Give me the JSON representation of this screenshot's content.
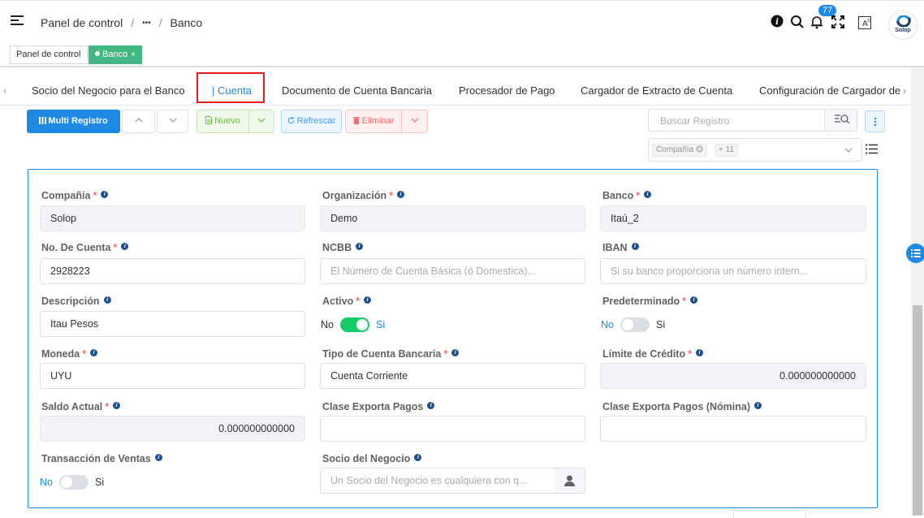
{
  "breadcrumb": {
    "home": "Panel de control",
    "ellipsis": "•••",
    "current": "Banco"
  },
  "header": {
    "notification_count": "77",
    "logo_text": "Solop"
  },
  "tags": {
    "items": [
      {
        "label": "Panel de control"
      },
      {
        "label": "Banco",
        "close": "×"
      }
    ],
    "active_color": "#42b983"
  },
  "tabs": {
    "items": [
      {
        "label": "Socio del Negocio para el Banco"
      },
      {
        "label": "| Cuenta"
      },
      {
        "label": "Documento de Cuenta Bancaria"
      },
      {
        "label": "Procesador de Pago"
      },
      {
        "label": "Cargador de Extracto de Cuenta"
      },
      {
        "label": "Configuración de Cargador de"
      }
    ],
    "active_index": 1,
    "left_arrow": "‹",
    "right_arrow": "›"
  },
  "toolbar": {
    "multi_registro": "Multi Registro",
    "nuevo": "Nuevo",
    "refrescar": "Refrescar",
    "eliminar": "Eliminar",
    "search_placeholder": "Buscar Registro",
    "filter_chip": "Compañía",
    "filter_more": "+ 11"
  },
  "form": {
    "compania": {
      "label": "Compañía",
      "value": "Solop"
    },
    "organizacion": {
      "label": "Organización",
      "value": "Demo"
    },
    "banco": {
      "label": "Banco",
      "value": "Itaú_2"
    },
    "no_cuenta": {
      "label": "No. De Cuenta",
      "value": "2928223"
    },
    "ncbb": {
      "label": "NCBB",
      "placeholder": "El Número de Cuenta Básica (ó Domestica)..."
    },
    "iban": {
      "label": "IBAN",
      "placeholder": "Si su banco proporciona un número intern..."
    },
    "descripcion": {
      "label": "Descripción",
      "value": "Itau Pesos"
    },
    "activo": {
      "label": "Activo",
      "no": "No",
      "si": "Si",
      "on": true
    },
    "predeterminado": {
      "label": "Predeterminado",
      "no": "No",
      "si": "Si",
      "on": false
    },
    "moneda": {
      "label": "Moneda",
      "value": "UYU"
    },
    "tipo_cuenta": {
      "label": "Tipo de Cuenta Bancaria",
      "value": "Cuenta Corriente"
    },
    "limite_credito": {
      "label": "Límite de Crédito",
      "value": "0.000000000000"
    },
    "saldo_actual": {
      "label": "Saldo Actual",
      "value": "0.000000000000"
    },
    "clase_exporta": {
      "label": "Clase Exporta Pagos",
      "value": ""
    },
    "clase_exporta_nomina": {
      "label": "Clase Exporta Pagos (Nómina)",
      "value": ""
    },
    "transaccion_ventas": {
      "label": "Transacción de Ventas",
      "no": "No",
      "si": "Si",
      "on": false
    },
    "socio_negocio": {
      "label": "Socio del Negocio",
      "placeholder": "Un Socio del Negocio es cualquiera con q..."
    },
    "required_mark": "*",
    "info_mark": "i"
  },
  "colors": {
    "primary": "#1e88e5",
    "highlight": "#e0201a",
    "switch_on": "#13ce66"
  },
  "icons": [
    "menu-icon",
    "info-icon",
    "search-icon",
    "bell-icon",
    "fullscreen-icon",
    "translate-icon",
    "logo-icon",
    "chevron-up-icon",
    "chevron-down-icon",
    "document-icon",
    "refresh-icon",
    "trash-icon",
    "search-list-icon",
    "more-vertical-icon",
    "list-icon",
    "user-icon"
  ]
}
